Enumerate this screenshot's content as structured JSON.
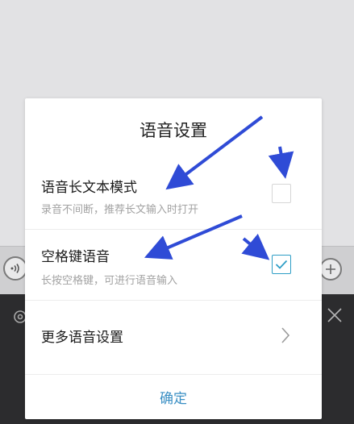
{
  "dialog": {
    "title": "语音设置",
    "items": [
      {
        "title": "语音长文本模式",
        "subtitle": "录音不间断，推荐长文输入时打开",
        "checked": false
      },
      {
        "title": "空格键语音",
        "subtitle": "长按空格键，可进行语音输入",
        "checked": true
      },
      {
        "title": "更多语音设置"
      }
    ],
    "confirm_label": "确定"
  },
  "colors": {
    "accent": "#2e9ec6",
    "confirm_text": "#3a8fc4",
    "annotation_arrow": "#2f4bd6",
    "keyboard_bg": "#2c2c2e"
  },
  "icons": {
    "voice": "voice-wave-icon",
    "plus": "plus-icon",
    "settings": "gear-icon",
    "close": "close-icon",
    "chevron": "chevron-right-icon",
    "check": "checkmark-icon"
  }
}
